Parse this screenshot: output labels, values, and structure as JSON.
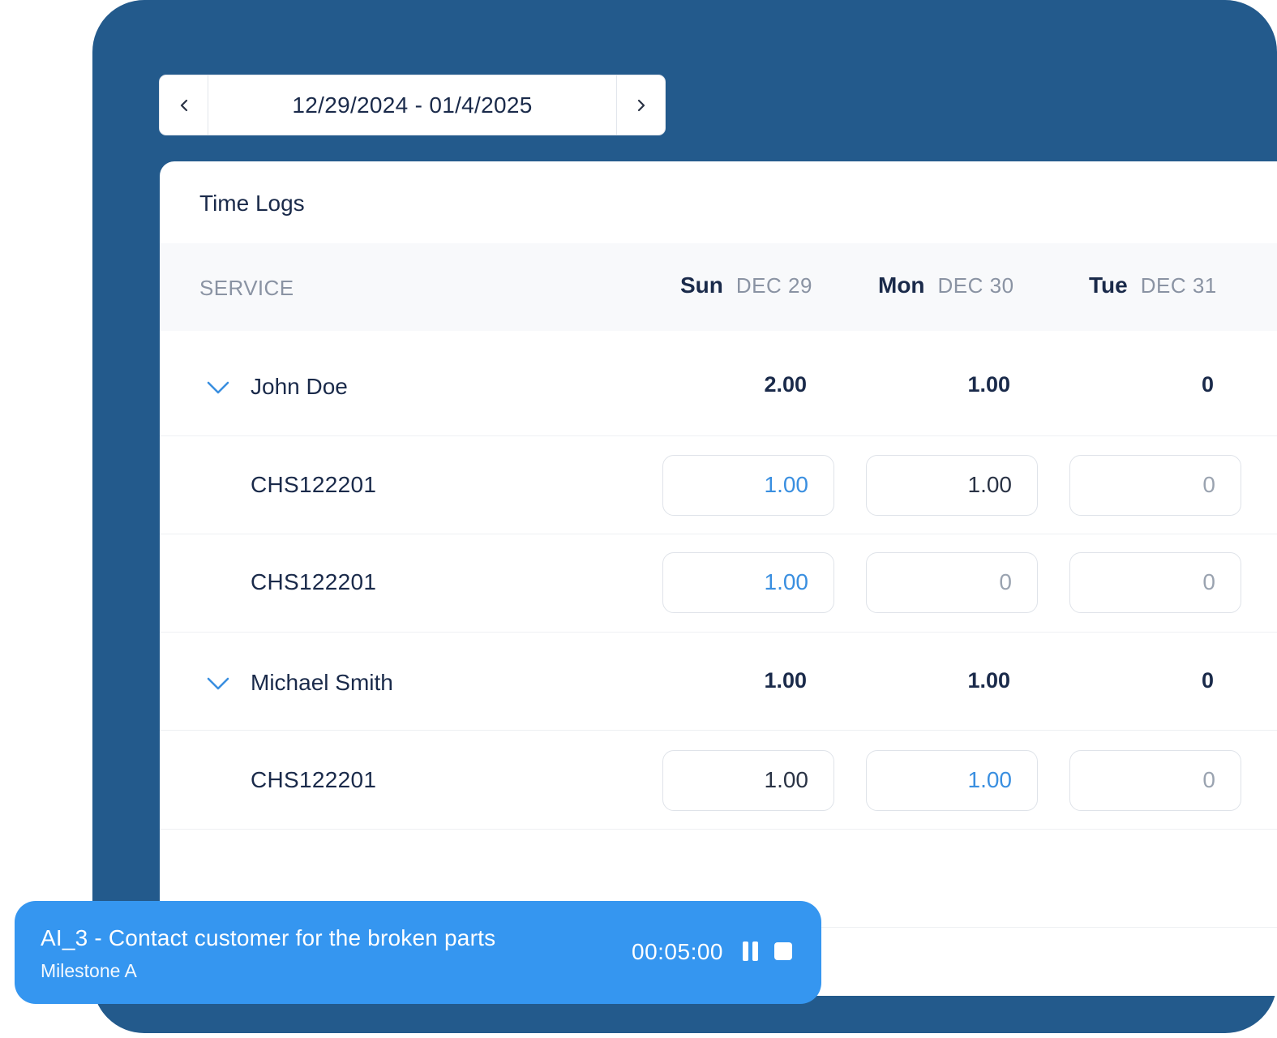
{
  "date_nav": {
    "range": "12/29/2024 - 01/4/2025",
    "prev_icon": "chevron-left-icon",
    "next_icon": "chevron-right-icon"
  },
  "panel": {
    "title": "Time Logs",
    "service_header": "SERVICE",
    "days": [
      {
        "name": "Sun",
        "date": "DEC 29"
      },
      {
        "name": "Mon",
        "date": "DEC 30"
      },
      {
        "name": "Tue",
        "date": "DEC 31"
      }
    ]
  },
  "groups": [
    {
      "name": "John Doe",
      "totals": [
        "2.00",
        "1.00",
        "0"
      ],
      "items": [
        {
          "service": "CHS122201",
          "values": [
            "1.00",
            "1.00",
            "0"
          ]
        },
        {
          "service": "CHS122201",
          "values": [
            "1.00",
            "0",
            "0"
          ]
        }
      ]
    },
    {
      "name": "Michael Smith",
      "totals": [
        "1.00",
        "1.00",
        "0"
      ],
      "items": [
        {
          "service": "CHS122201",
          "values": [
            "1.00",
            "1.00",
            "0"
          ]
        }
      ]
    }
  ],
  "timer": {
    "task": "AI_3 - Contact customer for the broken parts",
    "milestone": "Milestone A",
    "elapsed": "00:05:00",
    "pause_icon": "pause-icon",
    "stop_icon": "stop-icon"
  },
  "colors": {
    "frame": "#235a8c",
    "accent": "#3596f0",
    "active_value": "#3a8fe0"
  }
}
